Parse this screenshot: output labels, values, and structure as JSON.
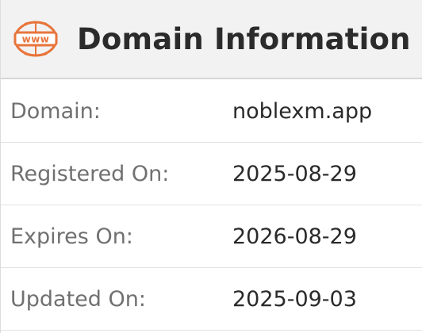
{
  "header": {
    "title": "Domain Information",
    "icon": "www-globe-icon",
    "icon_text": "www",
    "icon_color": "#e8743b"
  },
  "rows": [
    {
      "label": "Domain:",
      "value": "noblexm.app"
    },
    {
      "label": "Registered On:",
      "value": "2025-08-29"
    },
    {
      "label": "Expires On:",
      "value": "2026-08-29"
    },
    {
      "label": "Updated On:",
      "value": "2025-09-03"
    }
  ]
}
